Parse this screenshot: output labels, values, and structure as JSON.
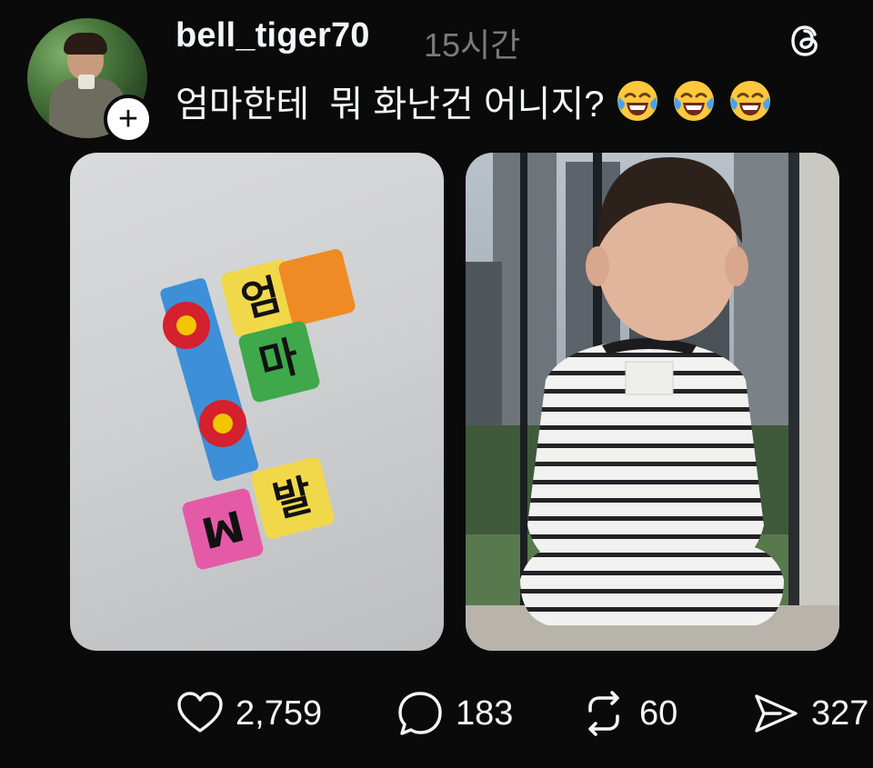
{
  "post": {
    "username": "bell_tiger70",
    "timestamp": "15시간",
    "caption": "엄마한테  뭐 화난건 어니지?",
    "caption_emojis": [
      "face-with-tears-of-joy",
      "face-with-tears-of-joy",
      "face-with-tears-of-joy"
    ],
    "follow_badge": "+",
    "images": [
      {
        "name": "toy-blocks-photo",
        "block_letters": [
          "엄",
          "마",
          "발",
          "M"
        ]
      },
      {
        "name": "baby-at-window-photo"
      }
    ]
  },
  "actions": {
    "likes": "2,759",
    "comments": "183",
    "reposts": "60",
    "shares": "327"
  },
  "icons": {
    "logo": "threads-logo-icon",
    "like": "heart-icon",
    "comment": "speech-bubble-icon",
    "repost": "repost-arrows-icon",
    "share": "paper-plane-icon"
  },
  "colors": {
    "background": "#0a0a0a",
    "text": "#f3f5f7",
    "muted": "#7a7a7a"
  }
}
